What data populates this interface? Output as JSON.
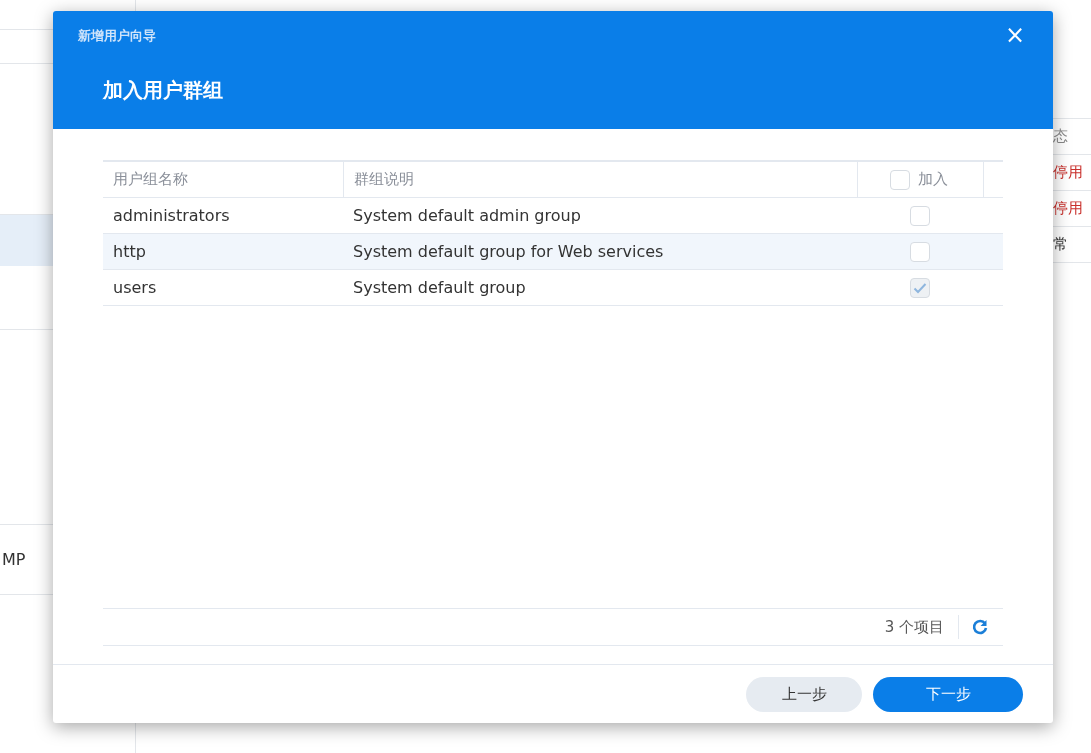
{
  "background": {
    "left_items": [
      "MP"
    ],
    "right_items": [
      {
        "text": "态",
        "kind": "header"
      },
      {
        "text": "停用",
        "kind": "disabled"
      },
      {
        "text": "停用",
        "kind": "disabled"
      },
      {
        "text": "常",
        "kind": "normal"
      }
    ]
  },
  "dialog": {
    "title": "新增用户向导",
    "heading": "加入用户群组",
    "close": "×",
    "table": {
      "columns": [
        "用户组名称",
        "群组说明",
        "加入"
      ],
      "select_all": {
        "checked": false
      },
      "rows": [
        {
          "name": "administrators",
          "description": "System default admin group",
          "checked": false,
          "disabled": false,
          "selected": false
        },
        {
          "name": "http",
          "description": "System default group for Web services",
          "checked": false,
          "disabled": false,
          "selected": true
        },
        {
          "name": "users",
          "description": "System default group",
          "checked": true,
          "disabled": true,
          "selected": false
        }
      ]
    },
    "item_count": "3 个项目",
    "buttons": [
      {
        "label": "上一步",
        "kind": "secondary"
      },
      {
        "label": "下一步",
        "kind": "primary"
      }
    ]
  }
}
